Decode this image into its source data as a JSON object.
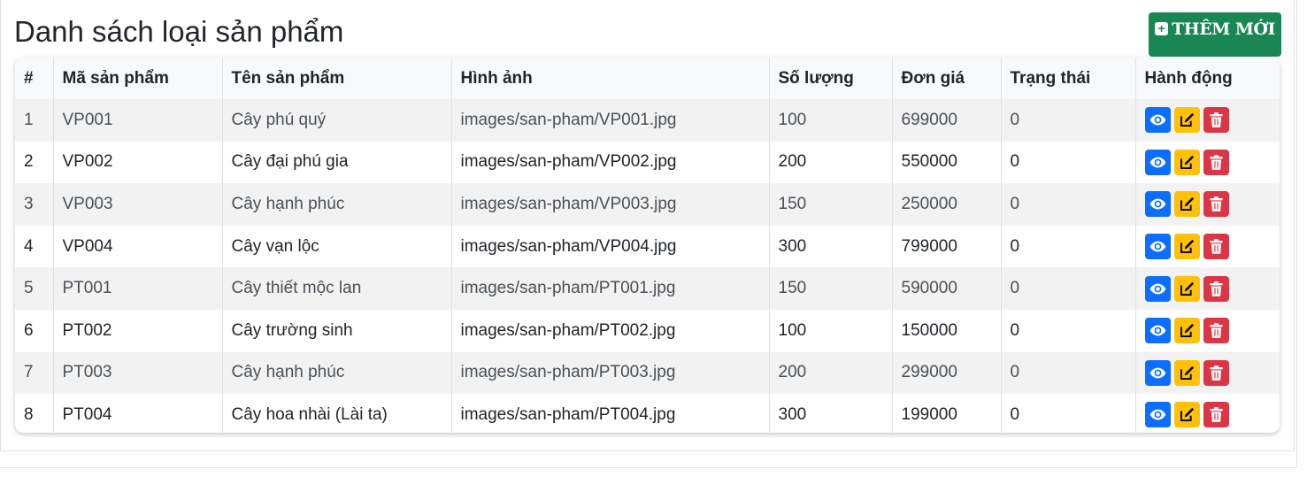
{
  "page": {
    "title": "Danh sách loại sản phẩm",
    "add_button_label": "THÊM MỚI",
    "add_icon": "plus-square-icon"
  },
  "table": {
    "headers": [
      "#",
      "Mã sản phẩm",
      "Tên sản phẩm",
      "Hình ảnh",
      "Số lượng",
      "Đơn giá",
      "Trạng thái",
      "Hành động"
    ],
    "rows": [
      [
        "1",
        "VP001",
        "Cây phú quý",
        "images/san-pham/VP001.jpg",
        "100",
        "699000",
        "0"
      ],
      [
        "2",
        "VP002",
        "Cây đại phú gia",
        "images/san-pham/VP002.jpg",
        "200",
        "550000",
        "0"
      ],
      [
        "3",
        "VP003",
        "Cây hạnh phúc",
        "images/san-pham/VP003.jpg",
        "150",
        "250000",
        "0"
      ],
      [
        "4",
        "VP004",
        "Cây vạn lộc",
        "images/san-pham/VP004.jpg",
        "300",
        "799000",
        "0"
      ],
      [
        "5",
        "PT001",
        "Cây thiết mộc lan",
        "images/san-pham/PT001.jpg",
        "150",
        "590000",
        "0"
      ],
      [
        "6",
        "PT002",
        "Cây trường sinh",
        "images/san-pham/PT002.jpg",
        "100",
        "150000",
        "0"
      ],
      [
        "7",
        "PT003",
        "Cây hạnh phúc",
        "images/san-pham/PT003.jpg",
        "200",
        "299000",
        "0"
      ],
      [
        "8",
        "PT004",
        "Cây hoa nhài (Lài ta)",
        "images/san-pham/PT004.jpg",
        "300",
        "199000",
        "0"
      ]
    ],
    "action_icons": [
      "eye-icon",
      "edit-icon",
      "trash-icon"
    ]
  },
  "colors": {
    "add_button": "#198754",
    "view_button": "#0d6efd",
    "edit_button": "#ffc107",
    "delete_button": "#dc3545",
    "striped_row": "#f2f2f2"
  }
}
